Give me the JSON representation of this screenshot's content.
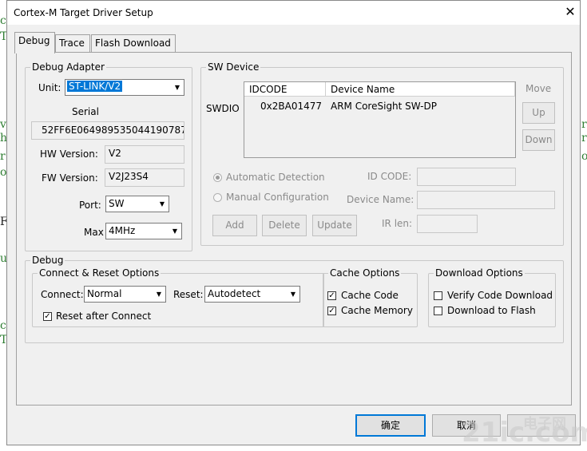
{
  "background_fragments": [
    "c",
    "T",
    "v",
    "h",
    "r",
    "o",
    "F",
    "u",
    "c",
    "T",
    "r",
    "r",
    "o"
  ],
  "window": {
    "title": "Cortex-M Target Driver Setup",
    "close_glyph": "✕"
  },
  "tabs": [
    {
      "label": "Debug",
      "active": true
    },
    {
      "label": "Trace",
      "active": false
    },
    {
      "label": "Flash Download",
      "active": false
    }
  ],
  "debug_adapter": {
    "legend": "Debug Adapter",
    "unit_label": "Unit:",
    "unit_value": "ST-LINK/V2",
    "serial_label": "Serial",
    "serial_value": "52FF6E064989535044190787",
    "hw_label": "HW Version:",
    "hw_value": "V2",
    "fw_label": "FW Version:",
    "fw_value": "V2J23S4",
    "port_label": "Port:",
    "port_value": "SW",
    "max_label": "Max",
    "max_value": "4MHz"
  },
  "sw_device": {
    "legend": "SW Device",
    "row_label": "SWDIO",
    "columns": [
      "IDCODE",
      "Device Name"
    ],
    "rows": [
      {
        "idcode": "0x2BA01477",
        "device_name": "ARM CoreSight SW-DP"
      }
    ],
    "move_label": "Move",
    "up_label": "Up",
    "down_label": "Down",
    "auto_detect_label": "Automatic Detection",
    "manual_config_label": "Manual Configuration",
    "id_code_label": "ID CODE:",
    "device_name_label": "Device Name:",
    "ir_len_label": "IR len:",
    "add_label": "Add",
    "delete_label": "Delete",
    "update_label": "Update"
  },
  "debug": {
    "legend": "Debug",
    "connect_reset": {
      "legend": "Connect & Reset Options",
      "connect_label": "Connect:",
      "connect_value": "Normal",
      "reset_label": "Reset:",
      "reset_value": "Autodetect",
      "reset_after_connect_label": "Reset after Connect",
      "reset_after_connect_checked": true
    },
    "cache": {
      "legend": "Cache Options",
      "cache_code_label": "Cache Code",
      "cache_code_checked": true,
      "cache_memory_label": "Cache Memory",
      "cache_memory_checked": true
    },
    "download": {
      "legend": "Download Options",
      "verify_label": "Verify Code Download",
      "verify_checked": false,
      "download_flash_label": "Download to Flash",
      "download_flash_checked": false
    }
  },
  "footer": {
    "ok_label": "确定",
    "cancel_label": "取消"
  },
  "watermark": {
    "text": "21ic.com",
    "brand": "电子网"
  },
  "colors": {
    "selection": "#0078d7",
    "default_button_border": "#0078d7",
    "bg_text": "#2e7d32"
  },
  "icons": {
    "dropdown": "▼",
    "check": "✓"
  }
}
